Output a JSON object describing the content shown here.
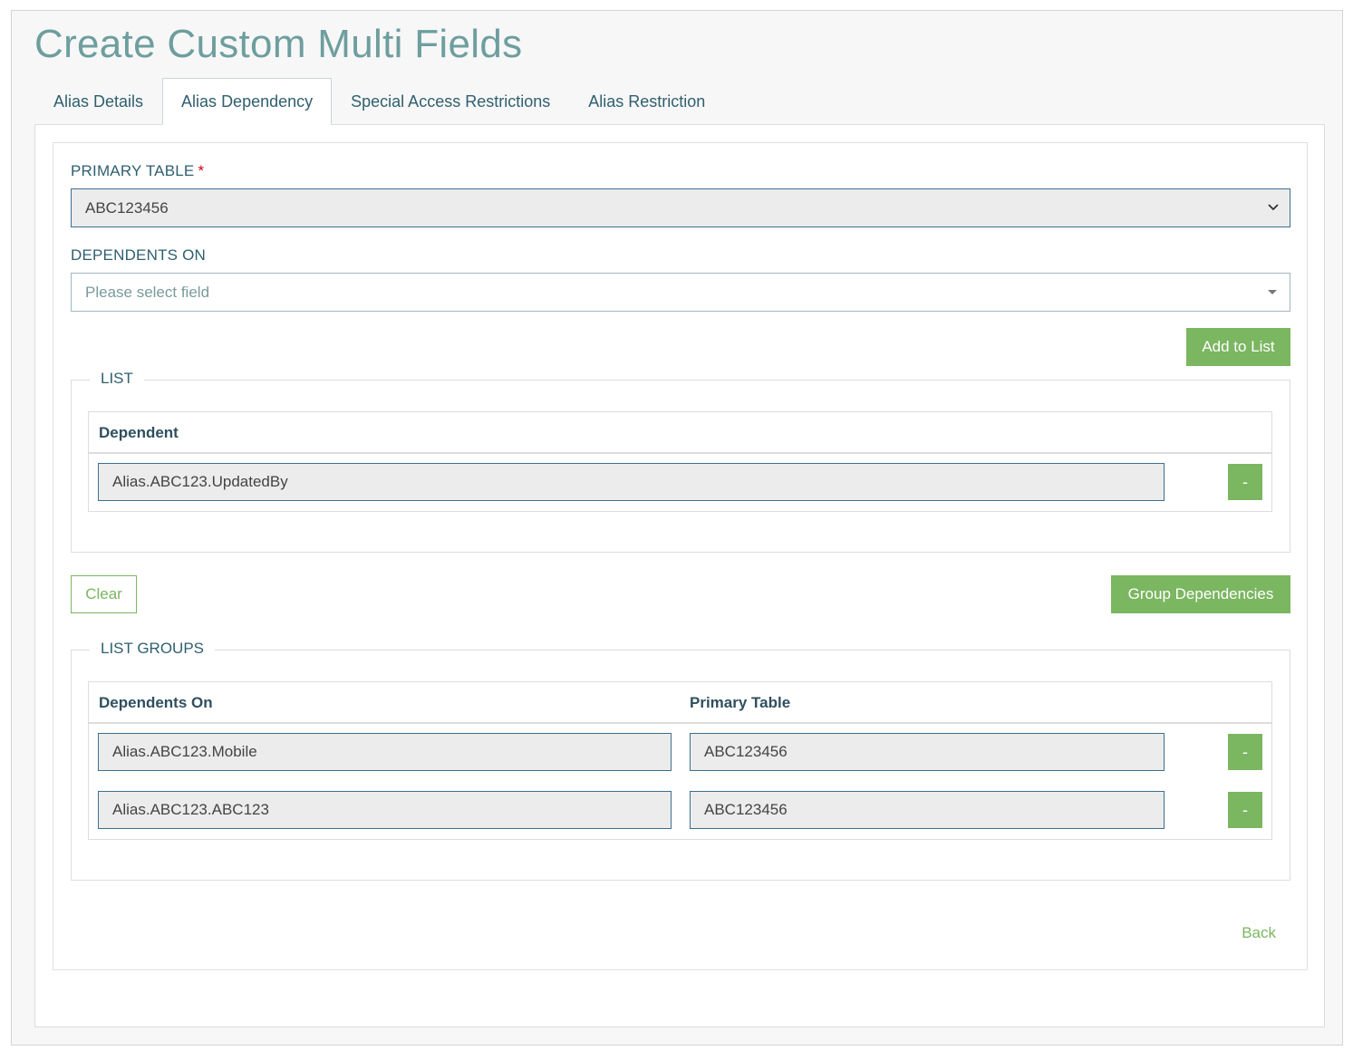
{
  "page": {
    "title": "Create Custom Multi Fields"
  },
  "tabs": [
    {
      "label": "Alias Details",
      "active": false
    },
    {
      "label": "Alias Dependency",
      "active": true
    },
    {
      "label": "Special Access Restrictions",
      "active": false
    },
    {
      "label": "Alias Restriction",
      "active": false
    }
  ],
  "form": {
    "primary_table": {
      "label": "PRIMARY TABLE",
      "required_mark": "*",
      "value": "ABC123456"
    },
    "dependents_on": {
      "label": "DEPENDENTS ON",
      "placeholder": "Please select field"
    },
    "add_to_list_label": "Add to List",
    "clear_label": "Clear",
    "group_dependencies_label": "Group Dependencies",
    "back_label": "Back"
  },
  "list": {
    "legend": "LIST",
    "header": {
      "dependent": "Dependent"
    },
    "rows": [
      {
        "dependent": "Alias.ABC123.UpdatedBy",
        "remove_label": "-"
      }
    ]
  },
  "list_groups": {
    "legend": "LIST GROUPS",
    "header": {
      "dependents_on": "Dependents On",
      "primary_table": "Primary Table"
    },
    "rows": [
      {
        "dependents_on": "Alias.ABC123.Mobile",
        "primary_table": "ABC123456",
        "remove_label": "-"
      },
      {
        "dependents_on": "Alias.ABC123.ABC123",
        "primary_table": "ABC123456",
        "remove_label": "-"
      }
    ]
  },
  "colors": {
    "accent_green": "#7bb661",
    "title_teal": "#6e9e9e",
    "input_border": "#3d6f8f"
  }
}
